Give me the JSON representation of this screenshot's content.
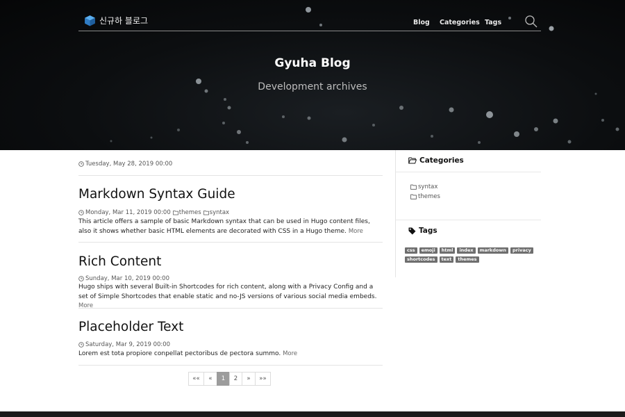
{
  "header": {
    "brand": "신규하 블로그",
    "nav": [
      "Blog",
      "Categories",
      "Tags"
    ],
    "title": "Gyuha Blog",
    "subtitle": "Development archives"
  },
  "main": {
    "top_date": "Tuesday, May 28, 2019 00:00",
    "posts": [
      {
        "title": "Markdown Syntax Guide",
        "date": "Monday, Mar 11, 2019 00:00",
        "categories": [
          "themes",
          "syntax"
        ],
        "excerpt": "This article offers a sample of basic Markdown syntax that can be used in Hugo content files, also it shows whether basic HTML elements are decorated with CSS in a Hugo theme.",
        "more": "More"
      },
      {
        "title": "Rich Content",
        "date": "Sunday, Mar 10, 2019 00:00",
        "categories": [],
        "excerpt": "Hugo ships with several Built-in Shortcodes for rich content, along with a Privacy Config and a set of Simple Shortcodes that enable static and no-JS versions of various social media embeds.",
        "more": "More"
      },
      {
        "title": "Placeholder Text",
        "date": "Saturday, Mar 9, 2019 00:00",
        "categories": [],
        "excerpt": "Lorem est tota propiore conpellat pectoribus de pectora summo.",
        "more": "More"
      }
    ]
  },
  "pagination": {
    "first": "««",
    "prev": "«",
    "pages": [
      "1",
      "2"
    ],
    "current": "1",
    "next": "»",
    "last": "»»"
  },
  "sidebar": {
    "categories_title": "Categories",
    "categories": [
      "syntax",
      "themes"
    ],
    "tags_title": "Tags",
    "tags": [
      "css",
      "emoji",
      "html",
      "index",
      "markdown",
      "privacy",
      "shortcodes",
      "text",
      "themes"
    ]
  },
  "colors": {
    "hero_bg": "#0c0e10",
    "tag_bg": "#6e6e6e",
    "active_page": "#9c9c9c",
    "brand_icon": "#3a8fd9"
  },
  "icons": {
    "brand": "cube-icon",
    "search": "search-icon",
    "date": "clock-icon",
    "category": "folder-icon",
    "tags": "tag-icon"
  }
}
